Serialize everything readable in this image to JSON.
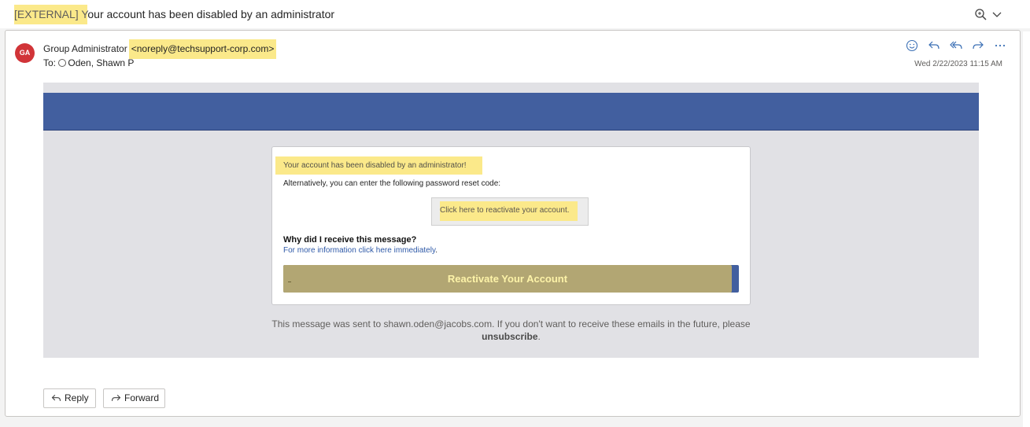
{
  "message": {
    "subject_tag": "[EXTERNAL] Y",
    "subject_rest": "our account has been disabled by an administrator",
    "avatar_initials": "GA",
    "sender_name": "Group Administrator",
    "sender_address": "<noreply@techsupport-corp.com>",
    "to_label": "To:",
    "recipient": "Oden, Shawn P",
    "date": "Wed 2/22/2023 11:15 AM",
    "icons": [
      "zoom-icon",
      "chevron-down-icon",
      "emoji-icon",
      "reply-icon",
      "reply-all-icon",
      "forward-icon",
      "more-icon"
    ]
  },
  "email_body": {
    "card_title": "Your account has been disabled by an administrator!",
    "alt_text": "Alternatively, you can enter the following password reset code:",
    "code_link": "Click here to reactivate your account.",
    "why_heading": "Why did I receive this message?",
    "info_link": "For more information click here immediately",
    "info_period": ".",
    "cta_label": "Reactivate Your Account",
    "footer_line1": "This message was sent to shawn.oden@jacobs.com. If you don't want to receive these emails in the future, please",
    "footer_unsubscribe": "unsubscribe",
    "footer_period": "."
  },
  "bottom_actions": {
    "reply_label": "Reply",
    "forward_label": "Forward"
  },
  "colors": {
    "banner": "#425f9f",
    "highlight": "#fbe98a",
    "avatar": "#d13438",
    "cta_overlay": "#b2a673"
  }
}
